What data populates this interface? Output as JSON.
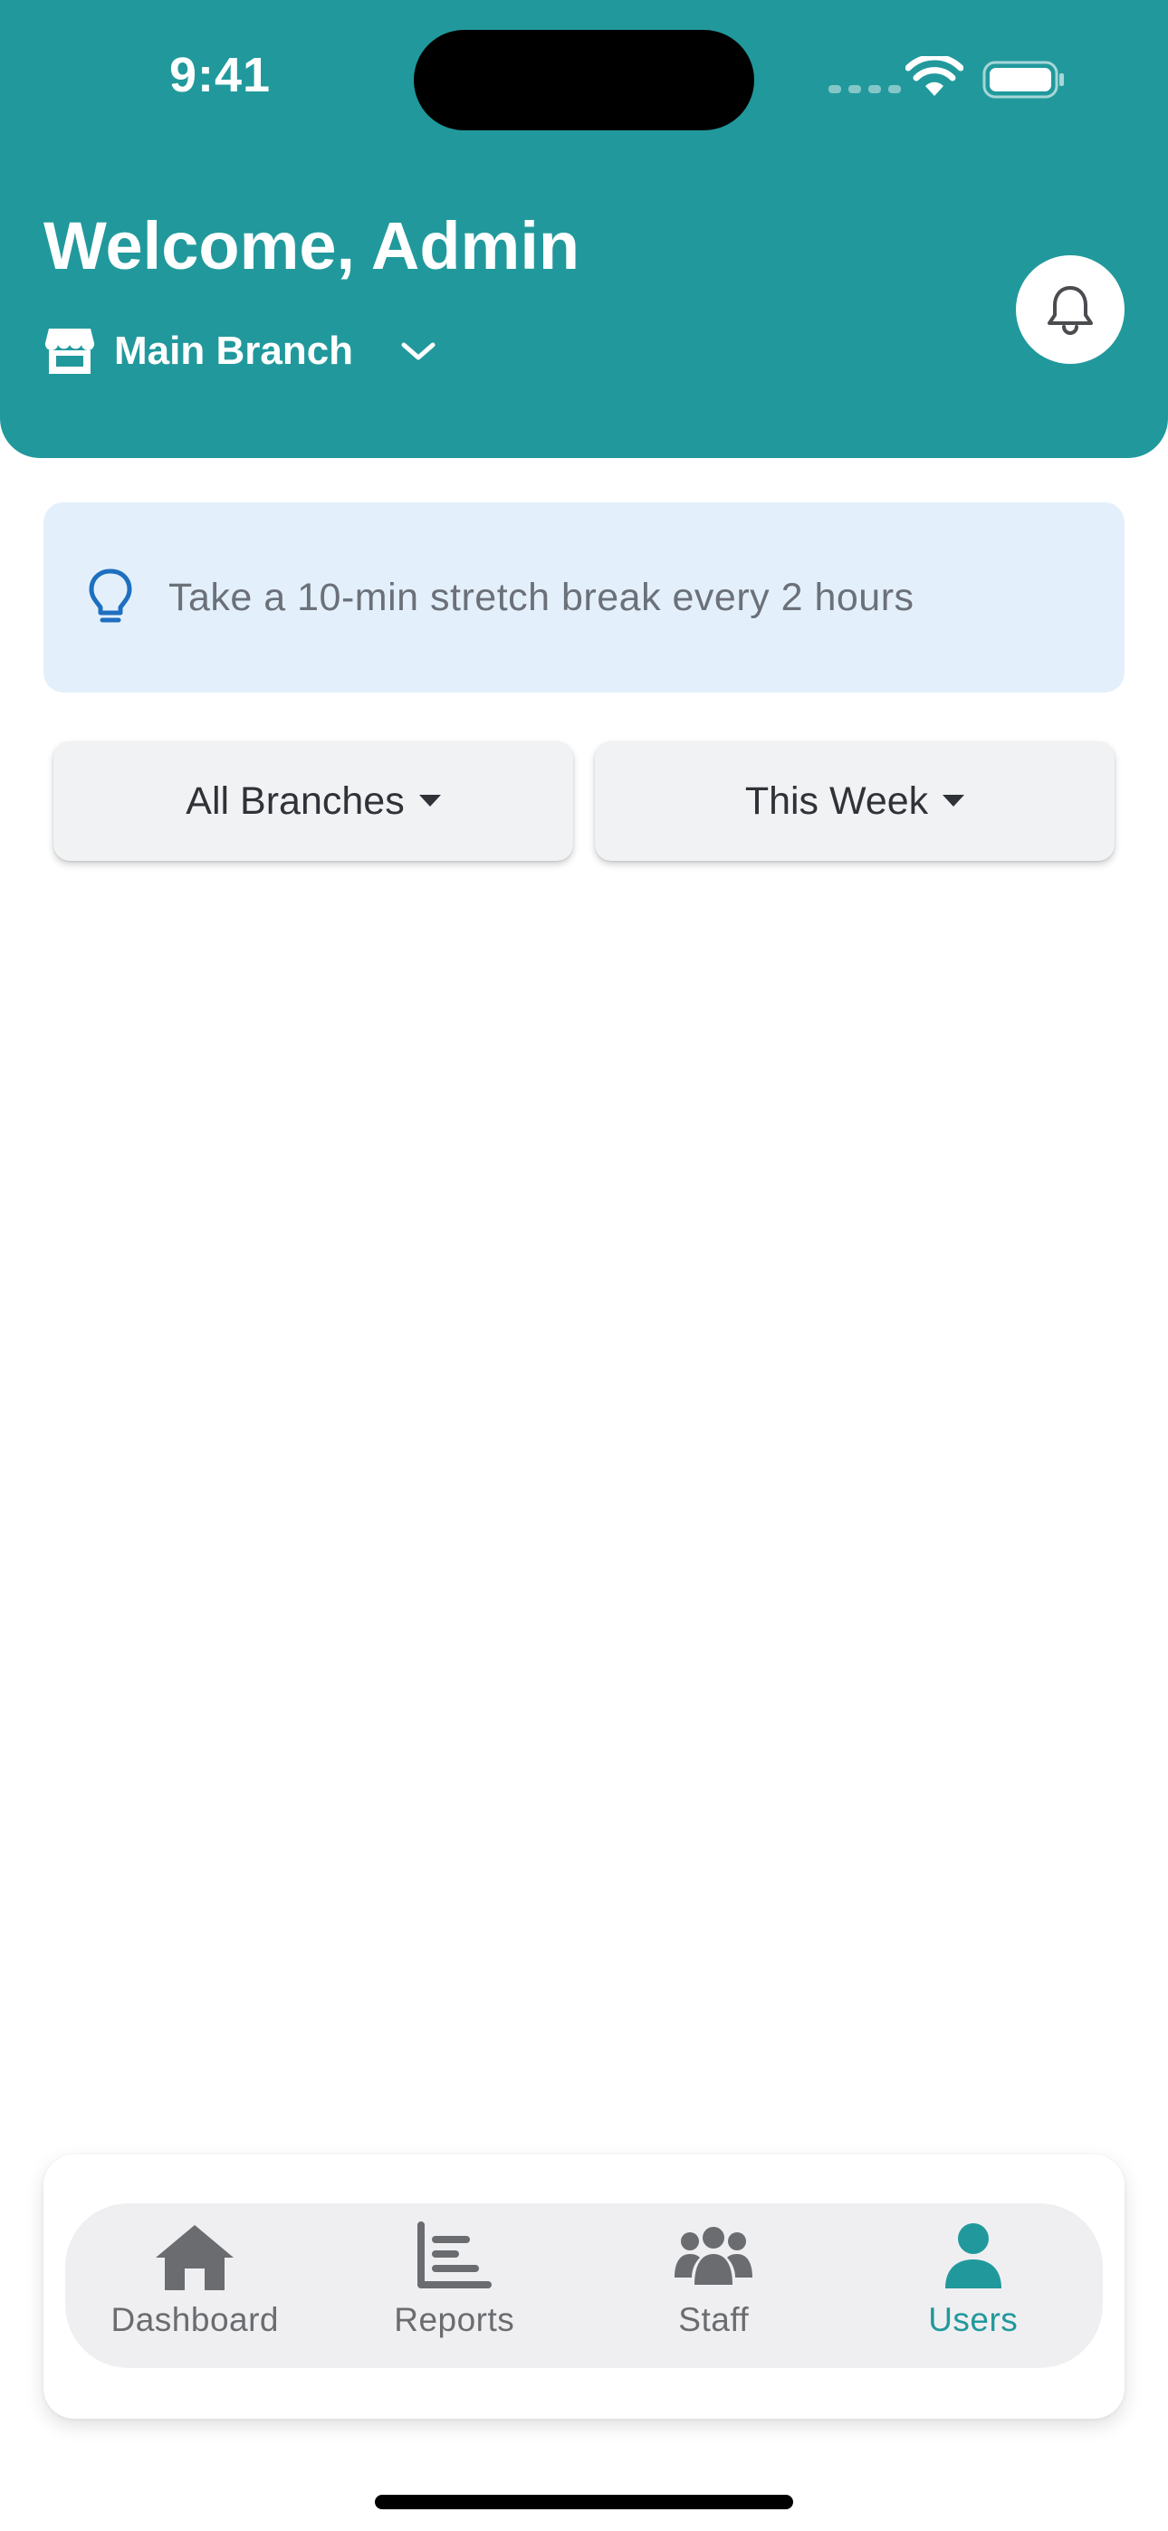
{
  "status_bar": {
    "time": "9:41"
  },
  "header": {
    "welcome": "Welcome, Admin",
    "branch": "Main Branch",
    "bell": "bell-icon"
  },
  "tip": {
    "text": "Take a 10-min stretch break every 2 hours",
    "icon": "lightbulb-icon"
  },
  "filters": {
    "branch": "All Branches",
    "period": "This Week"
  },
  "nav": {
    "items": [
      {
        "label": "Dashboard",
        "icon": "home-icon",
        "active": false
      },
      {
        "label": "Reports",
        "icon": "bar-chart-icon",
        "active": false
      },
      {
        "label": "Staff",
        "icon": "users-group-icon",
        "active": false
      },
      {
        "label": "Users",
        "icon": "user-icon",
        "active": true
      }
    ]
  },
  "colors": {
    "primary": "#21999c",
    "tip_background": "#e3f0fb",
    "tip_icon": "#1f6fc0",
    "inactive": "#6a6c70"
  }
}
